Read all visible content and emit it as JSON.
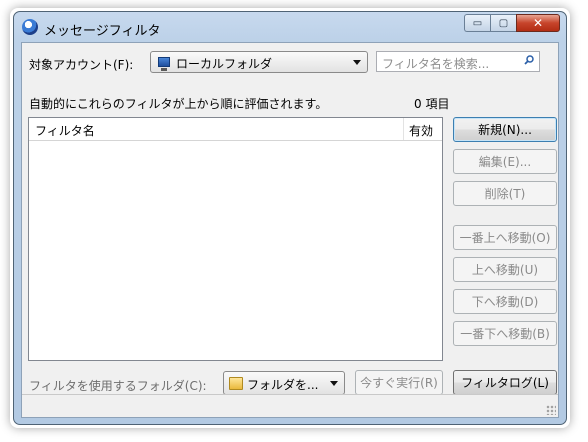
{
  "window": {
    "title": "メッセージフィルタ",
    "controls": {
      "minimize": "▭",
      "maximize": "▢",
      "close": "✕"
    }
  },
  "account": {
    "label": "対象アカウント(F):",
    "selected": "ローカルフォルダ"
  },
  "search": {
    "placeholder": "フィルタ名を検索..."
  },
  "info": {
    "description": "自動的にこれらのフィルタが上から順に評価されます。",
    "count": "0 項目"
  },
  "filter_list": {
    "columns": {
      "name": "フィルタ名",
      "enabled": "有効"
    },
    "rows": []
  },
  "buttons": {
    "new": "新規(N)...",
    "edit": "編集(E)...",
    "delete": "削除(T)",
    "move_top": "一番上へ移動(O)",
    "move_up": "上へ移動(U)",
    "move_down": "下へ移動(D)",
    "move_bottom": "一番下へ移動(B)"
  },
  "bottom": {
    "folder_label": "フィルタを使用するフォルダ(C):",
    "folder_selected": "フォルダを...",
    "run_now": "今すぐ実行(R)",
    "filter_log": "フィルタログ(L)"
  }
}
